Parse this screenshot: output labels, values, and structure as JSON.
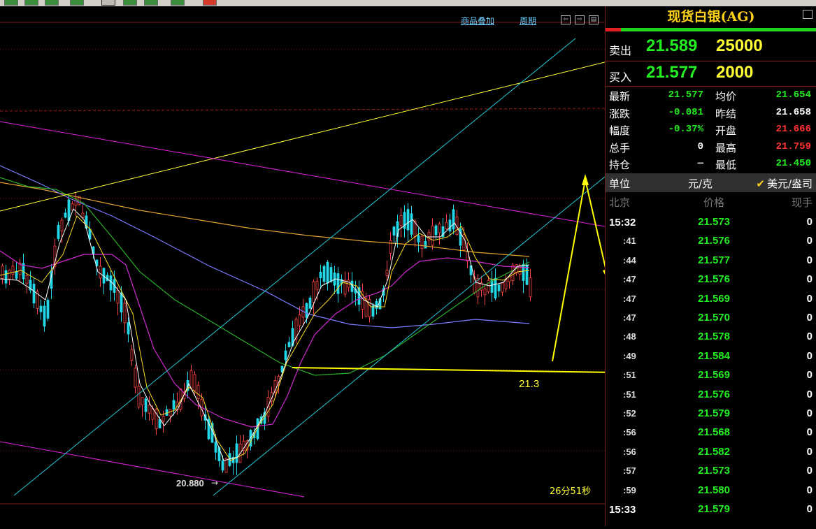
{
  "chart_menu": {
    "overlay": "商品叠加",
    "period": "周期"
  },
  "chart_labels": {
    "low_price": "20.880",
    "support": "21.3",
    "countdown": "26分51秒"
  },
  "quote": {
    "title": "现货白银(AG)",
    "sell": {
      "label": "卖出",
      "price": "21.589",
      "volume": "25000"
    },
    "buy": {
      "label": "买入",
      "price": "21.577",
      "volume": "2000"
    },
    "stats": [
      {
        "l1": "最新",
        "v1": "21.577",
        "c1": "#22ee22",
        "l2": "均价",
        "v2": "21.654",
        "c2": "#22ee22"
      },
      {
        "l1": "涨跌",
        "v1": "-0.081",
        "c1": "#22ee22",
        "l2": "昨结",
        "v2": "21.658",
        "c2": "#ffffff"
      },
      {
        "l1": "幅度",
        "v1": "-0.37%",
        "c1": "#22ee22",
        "l2": "开盘",
        "v2": "21.666",
        "c2": "#ff3333"
      },
      {
        "l1": "总手",
        "v1": "0",
        "c1": "#ffffff",
        "l2": "最高",
        "v2": "21.759",
        "c2": "#ff3333"
      },
      {
        "l1": "持仓",
        "v1": "—",
        "c1": "#ffffff",
        "l2": "最低",
        "v2": "21.450",
        "c2": "#22ee22"
      }
    ],
    "unit": {
      "label": "单位",
      "value": "元/克",
      "alt": "美元/盎司"
    },
    "tick_header": {
      "time": "北京",
      "price": "价格",
      "volume": "现手"
    },
    "ticks": [
      {
        "time": "15:32",
        "price": "21.573",
        "vol": "0"
      },
      {
        "time": ":41",
        "price": "21.576",
        "vol": "0"
      },
      {
        "time": ":44",
        "price": "21.577",
        "vol": "0"
      },
      {
        "time": ":47",
        "price": "21.576",
        "vol": "0"
      },
      {
        "time": ":47",
        "price": "21.569",
        "vol": "0"
      },
      {
        "time": ":47",
        "price": "21.570",
        "vol": "0"
      },
      {
        "time": ":48",
        "price": "21.578",
        "vol": "0"
      },
      {
        "time": ":49",
        "price": "21.584",
        "vol": "0"
      },
      {
        "time": ":51",
        "price": "21.569",
        "vol": "0"
      },
      {
        "time": ":51",
        "price": "21.576",
        "vol": "0"
      },
      {
        "time": ":52",
        "price": "21.579",
        "vol": "0"
      },
      {
        "time": ":56",
        "price": "21.568",
        "vol": "0"
      },
      {
        "time": ":56",
        "price": "21.582",
        "vol": "0"
      },
      {
        "time": ":57",
        "price": "21.573",
        "vol": "0"
      },
      {
        "time": ":59",
        "price": "21.580",
        "vol": "0"
      },
      {
        "time": "15:33",
        "price": "21.579",
        "vol": "0"
      }
    ]
  }
}
